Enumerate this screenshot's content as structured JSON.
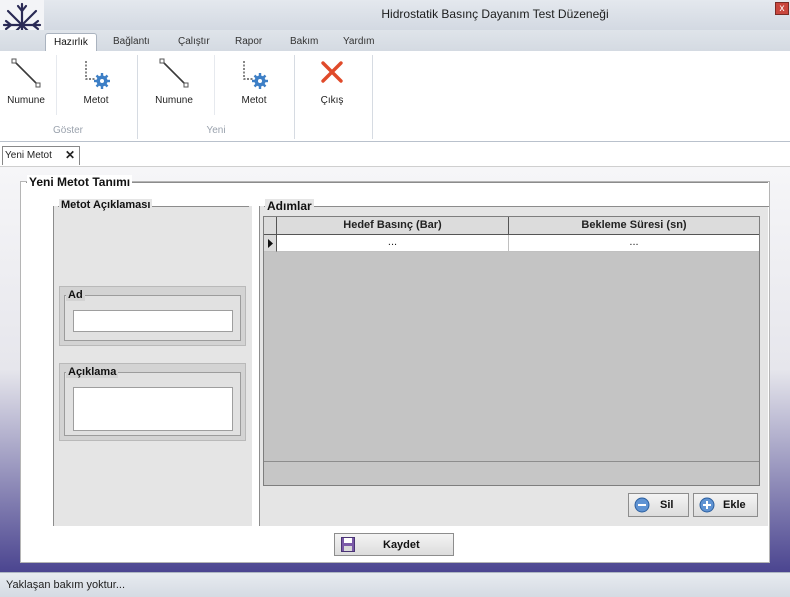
{
  "window": {
    "title": "Hidrostatik Basınç Dayanım Test Düzeneği",
    "close_glyph": "x"
  },
  "ribbon_tabs": [
    {
      "label": "Hazırlık"
    },
    {
      "label": "Bağlantı"
    },
    {
      "label": "Çalıştır"
    },
    {
      "label": "Rapor"
    },
    {
      "label": "Bakım"
    },
    {
      "label": "Yardım"
    }
  ],
  "ribbon": {
    "groups": [
      {
        "label": "Göster",
        "buttons": [
          {
            "label": "Numune",
            "icon": "line-icon"
          },
          {
            "label": "Metot",
            "icon": "method-gear-icon"
          }
        ]
      },
      {
        "label": "Yeni",
        "buttons": [
          {
            "label": "Numune",
            "icon": "line-icon"
          },
          {
            "label": "Metot",
            "icon": "method-gear-icon"
          }
        ]
      },
      {
        "label": "",
        "buttons": [
          {
            "label": "Çıkış",
            "icon": "close-x-icon"
          }
        ]
      }
    ]
  },
  "doc_tab": {
    "label": "Yeni Metot",
    "close_glyph": "✕"
  },
  "form": {
    "title": "Yeni Metot Tanımı",
    "left_title": "Metot Açıklaması",
    "name_label": "Ad",
    "name_value": "",
    "desc_label": "Açıklama",
    "desc_value": "",
    "right_title": "Adımlar",
    "grid": {
      "columns": [
        "Hedef Basınç (Bar)",
        "Bekleme Süresi (sn)"
      ],
      "rows": [
        [
          "...",
          "..."
        ]
      ]
    },
    "delete_label": "Sil",
    "add_label": "Ekle",
    "save_label": "Kaydet"
  },
  "status": {
    "text": "Yaklaşan bakım yoktur..."
  },
  "colors": {
    "accent_red": "#e04a2a",
    "gear_blue": "#3d7fc6",
    "snowflake": "#2a2a55"
  }
}
